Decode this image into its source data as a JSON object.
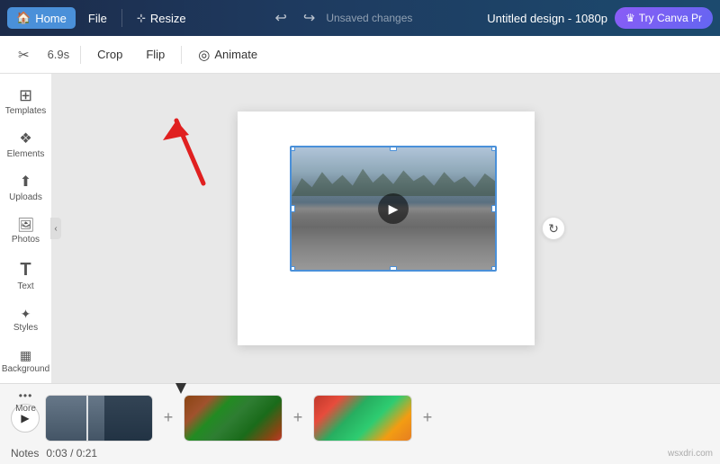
{
  "topbar": {
    "home_label": "Home",
    "file_label": "File",
    "resize_label": "Resize",
    "unsaved_text": "Unsaved changes",
    "design_title": "Untitled design - 1080p",
    "try_canva_label": "Try Canva Pr"
  },
  "toolbar2": {
    "duration_label": "6.9s",
    "crop_label": "Crop",
    "flip_label": "Flip",
    "animate_label": "Animate"
  },
  "sidebar": {
    "items": [
      {
        "label": "Templates",
        "icon": "⊞"
      },
      {
        "label": "Elements",
        "icon": "◈"
      },
      {
        "label": "Uploads",
        "icon": "↑"
      },
      {
        "label": "Photos",
        "icon": "🖼"
      },
      {
        "label": "Text",
        "icon": "T"
      },
      {
        "label": "Styles",
        "icon": "✦"
      },
      {
        "label": "Background",
        "icon": "▦"
      },
      {
        "label": "More",
        "icon": "•••"
      }
    ]
  },
  "canvas": {
    "rotate_icon": "↻",
    "side_refresh_icon": "↻"
  },
  "timeline": {
    "play_icon": "▶",
    "plus_icon": "+",
    "time_current": "0:03",
    "time_total": "0:21",
    "notes_label": "Notes",
    "time_separator": "/"
  },
  "watermark": "wsxdri.com"
}
